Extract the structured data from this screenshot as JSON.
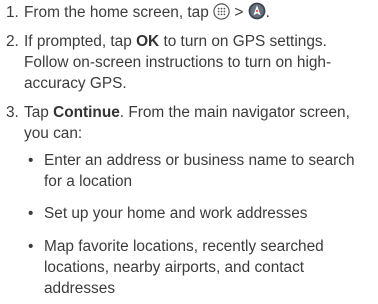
{
  "steps": [
    {
      "number": "1.",
      "text_before_icons": "From the home screen, tap ",
      "separator": " > ",
      "text_after_icons": ".",
      "icons": [
        "apps-grid-icon",
        "maps-navigator-icon"
      ]
    },
    {
      "number": "2.",
      "text_a": "If prompted, tap ",
      "bold": "OK",
      "text_b": " to turn on GPS settings. Follow on-screen instructions to turn on high-accuracy GPS."
    },
    {
      "number": "3.",
      "text_a": "Tap ",
      "bold": "Continue",
      "text_b": ". From the main navigator screen, you can:"
    }
  ],
  "bullets": [
    "Enter an address or business name to search for a location",
    "Set up your home and work addresses",
    "Map favorite locations, recently searched locations, nearby airports, and contact addresses"
  ],
  "bullet_char": "•"
}
